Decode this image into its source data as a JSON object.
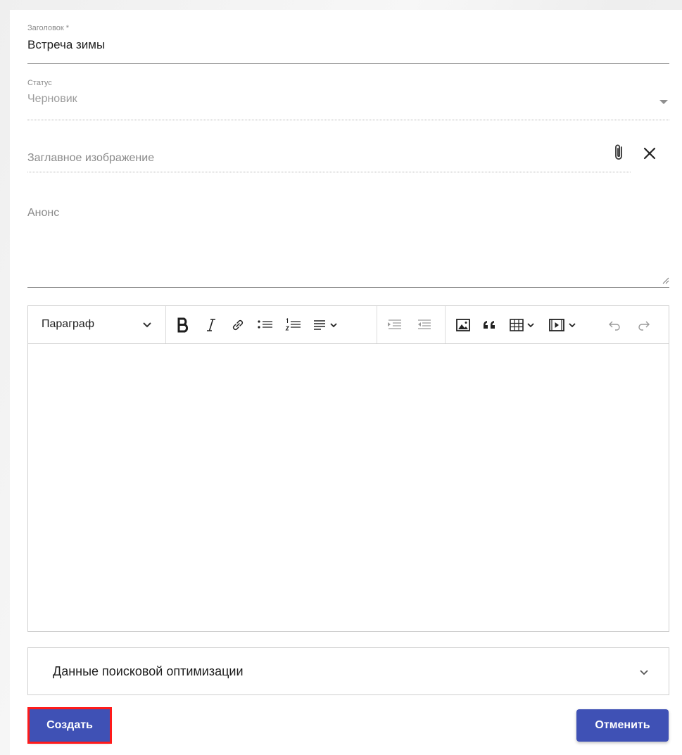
{
  "form": {
    "title_field": {
      "label": "Заголовок *",
      "value": "Встреча зимы"
    },
    "status_field": {
      "label": "Статус",
      "value": "Черновик"
    },
    "image_field": {
      "placeholder": "Заглавное изображение"
    },
    "anons_field": {
      "placeholder": "Анонс"
    }
  },
  "editor": {
    "paragraph_select": "Параграф",
    "toolbar_icons": [
      "bold-icon",
      "italic-icon",
      "link-icon",
      "bulleted-list-icon",
      "numbered-list-icon",
      "align-icon",
      "indent-icon",
      "outdent-icon",
      "image-icon",
      "quote-icon",
      "table-icon",
      "media-icon",
      "undo-icon",
      "redo-icon"
    ]
  },
  "seo": {
    "label": "Данные поисковой оптимизации"
  },
  "buttons": {
    "create": "Создать",
    "cancel": "Отменить"
  },
  "colors": {
    "primary": "#3f51b5",
    "highlight": "#ff1a1a"
  }
}
